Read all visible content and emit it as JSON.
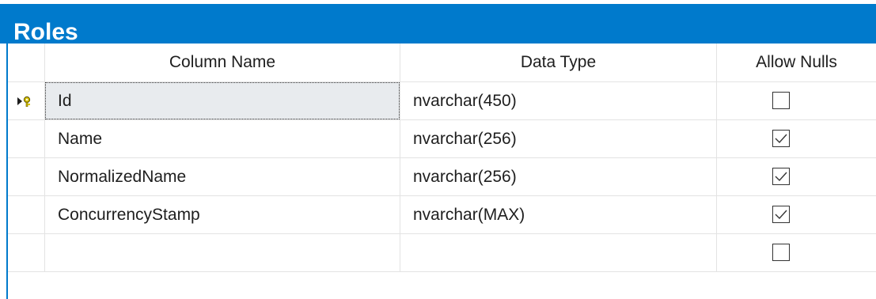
{
  "table": {
    "title": "Roles",
    "columns": {
      "name": "Column Name",
      "type": "Data Type",
      "nulls": "Allow Nulls"
    },
    "rows": [
      {
        "name": "Id",
        "type": "nvarchar(450)",
        "allow_nulls": false,
        "primary_key": true,
        "selected": true
      },
      {
        "name": "Name",
        "type": "nvarchar(256)",
        "allow_nulls": true,
        "primary_key": false,
        "selected": false
      },
      {
        "name": "NormalizedName",
        "type": "nvarchar(256)",
        "allow_nulls": true,
        "primary_key": false,
        "selected": false
      },
      {
        "name": "ConcurrencyStamp",
        "type": "nvarchar(MAX)",
        "allow_nulls": true,
        "primary_key": false,
        "selected": false
      },
      {
        "name": "",
        "type": "",
        "allow_nulls": false,
        "primary_key": false,
        "selected": false
      }
    ]
  },
  "icons": {
    "primary_key_row_indicator": "key-arrow-icon",
    "checked": "checkmark-icon"
  },
  "colors": {
    "title_bar": "#007acc",
    "selected_cell": "#e8ebee",
    "gridline": "#e3e3e3",
    "key_icon": "#d6c100"
  }
}
